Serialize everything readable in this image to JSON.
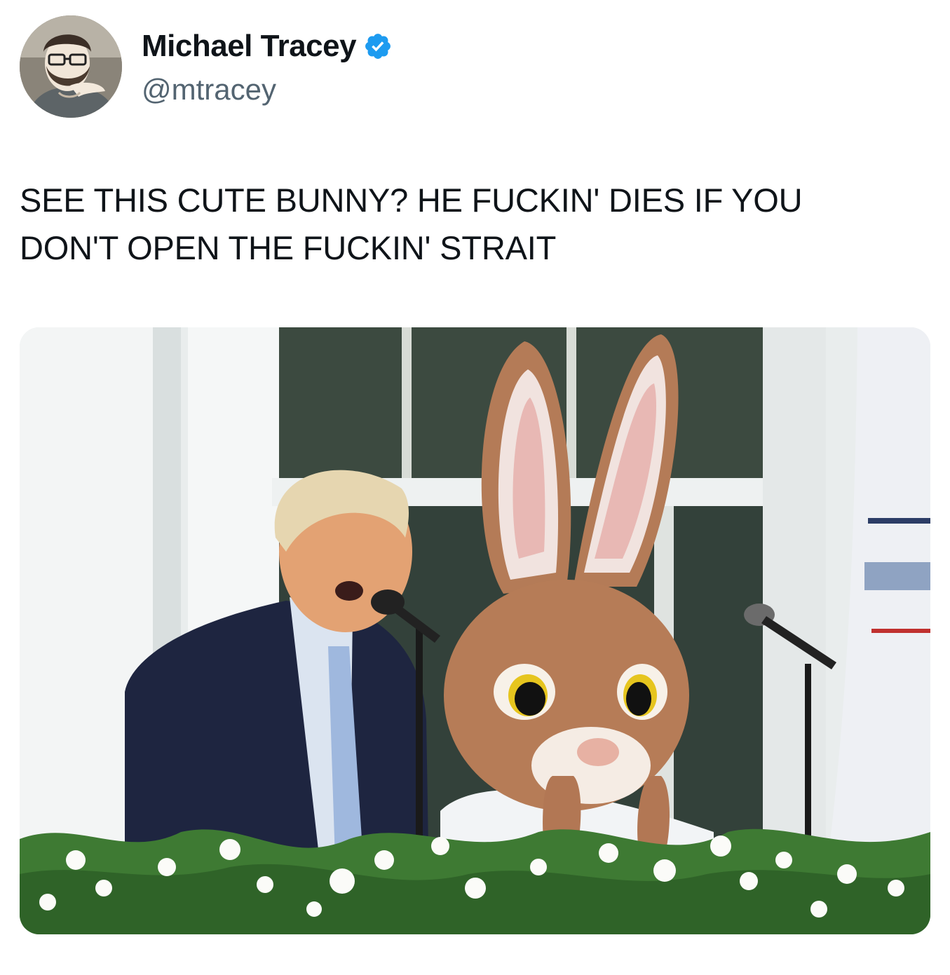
{
  "author": {
    "name": "Michael Tracey",
    "handle": "@mtracey",
    "verified": true,
    "verified_color": "#1d9bf0"
  },
  "tweet": {
    "text": "SEE THIS CUTE BUNNY? HE FUCKIN' DIES IF YOU\nDON'T OPEN THE FUCKIN' STRAIT"
  },
  "icons": {
    "avatar": "avatar-illustration-icon",
    "verified": "verified-check-icon"
  }
}
